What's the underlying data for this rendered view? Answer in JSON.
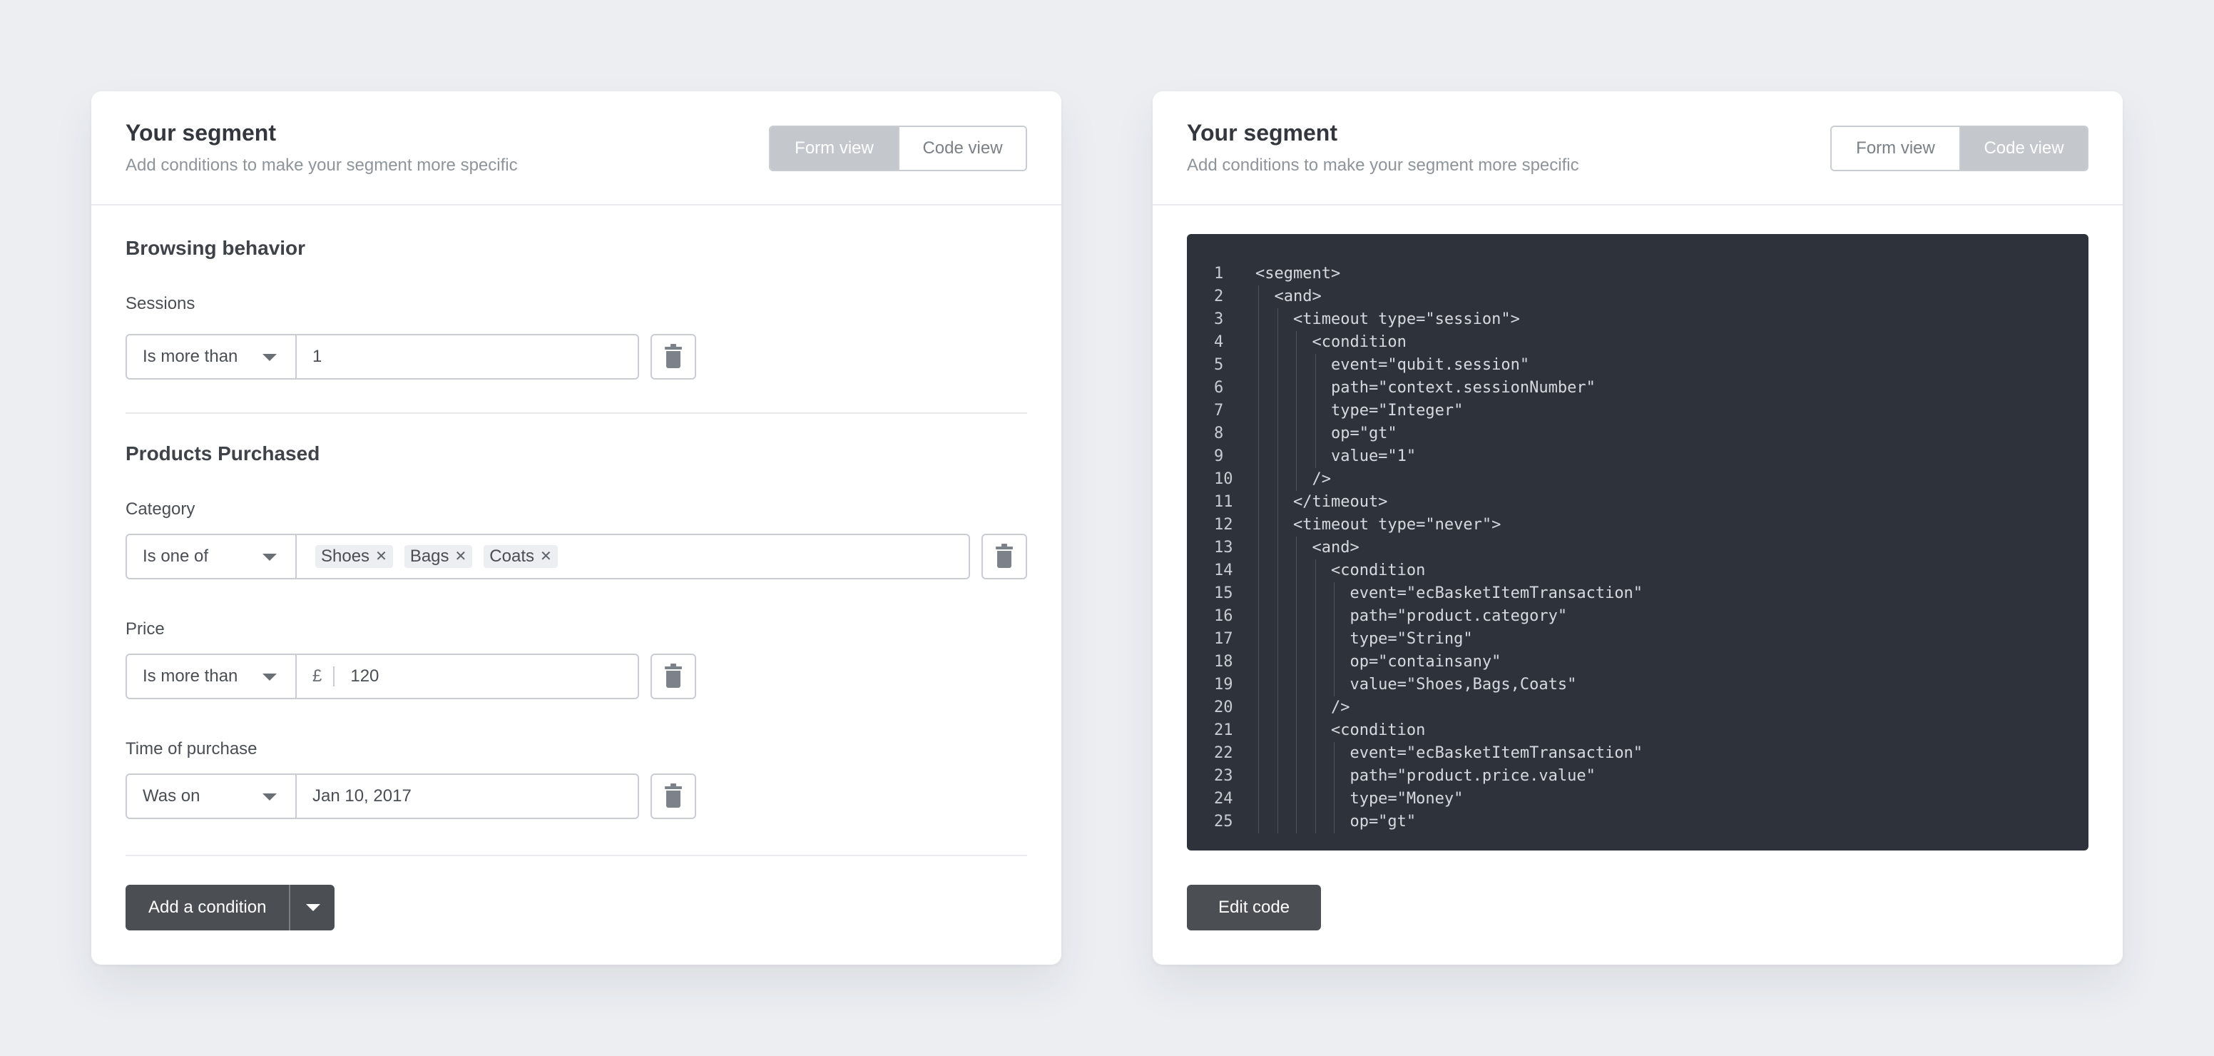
{
  "left": {
    "title": "Your segment",
    "subtitle": "Add conditions to make your segment more specific",
    "toggle": {
      "form": "Form view",
      "code": "Code view"
    },
    "browsing": {
      "title": "Browsing behavior",
      "sessions": {
        "label": "Sessions",
        "operator": "Is more than",
        "value": "1"
      }
    },
    "products": {
      "title": "Products Purchased",
      "category": {
        "label": "Category",
        "operator": "Is one of",
        "tags": [
          "Shoes",
          "Bags",
          "Coats"
        ]
      },
      "price": {
        "label": "Price",
        "operator": "Is more than",
        "currency": "£",
        "value": "120"
      },
      "time": {
        "label": "Time of purchase",
        "operator": "Was on",
        "value": "Jan 10, 2017"
      }
    },
    "add_condition": "Add a condition"
  },
  "right": {
    "title": "Your segment",
    "subtitle": "Add conditions to make your segment more specific",
    "toggle": {
      "form": "Form view",
      "code": "Code view"
    },
    "code_lines": [
      "<segment>",
      "  <and>",
      "    <timeout type=\"session\">",
      "      <condition",
      "        event=\"qubit.session\"",
      "        path=\"context.sessionNumber\"",
      "        type=\"Integer\"",
      "        op=\"gt\"",
      "        value=\"1\"",
      "      />",
      "    </timeout>",
      "    <timeout type=\"never\">",
      "      <and>",
      "        <condition",
      "          event=\"ecBasketItemTransaction\"",
      "          path=\"product.category\"",
      "          type=\"String\"",
      "          op=\"containsany\"",
      "          value=\"Shoes,Bags,Coats\"",
      "        />",
      "        <condition",
      "          event=\"ecBasketItemTransaction\"",
      "          path=\"product.price.value\"",
      "          type=\"Money\"",
      "          op=\"gt\""
    ],
    "edit_code": "Edit code"
  }
}
